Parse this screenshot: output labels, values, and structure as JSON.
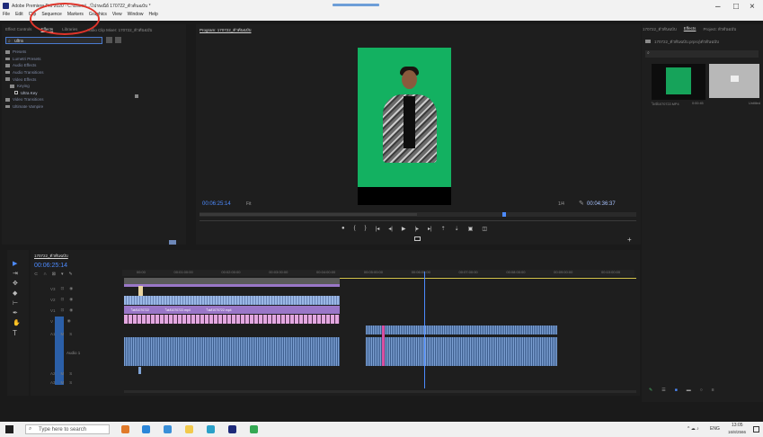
{
  "window": {
    "title": "Adobe Premiere Pro 2020 - C:\\Users\\...\\ไปรษณีย์ 170722_ตัวต้นฉบับ *",
    "menus": [
      "File",
      "Edit",
      "Clip",
      "Sequence",
      "Markers",
      "Graphics",
      "View",
      "Window",
      "Help"
    ],
    "controls": [
      "–",
      "□",
      "×"
    ]
  },
  "effects_panel": {
    "tabs": [
      "Effect Controls",
      "Effects",
      "Libraries",
      "Audio Clip Mixer: 170722_ตัวต้นฉบับ"
    ],
    "active_tab": "Effects",
    "search_value": "ultra",
    "tree": [
      "Presets",
      "Lumetri Presets",
      "Audio Effects",
      "Audio Transitions",
      "Video Effects",
      "Keying",
      "Ultra Key",
      "Video Transitions",
      "Ultimate Vampire"
    ]
  },
  "program_monitor": {
    "title": "Program: 170722_ตัวต้นฉบับ",
    "timecode_current": "00:06:25:14",
    "fit": "Fit",
    "quality": "1/4",
    "timecode_total": "00:04:36:37"
  },
  "project_panel": {
    "tabs": [
      "170722_ตัวต้นฉบับ",
      "Effects",
      "Project: ตัวต้นฉบับ"
    ],
    "path": "170722_ตัวต้นฉบับ.prproj\\ตัวต้นฉบับ",
    "items": [
      {
        "name": "ไฟล์1070722.MP4",
        "duration": "0:00:45"
      },
      {
        "name": "Untitled",
        "duration": ""
      }
    ]
  },
  "timeline": {
    "sequence_tab": "170722_ตัวต้นฉบับ",
    "timecode": "00:06:25:14",
    "ruler_labels": [
      "00:00",
      "00:01:00:00",
      "00:02:00:00",
      "00:03:00:00",
      "00:04:00:00",
      "00:05:00:00",
      "00:06:00:00",
      "00:07:00:00",
      "00:08:00:00",
      "00:09:00:00",
      "00:10:00:00"
    ],
    "track_labels": [
      "V3",
      "V2",
      "V1",
      "A1",
      "A2",
      "A3"
    ],
    "clip_labels": [
      "ไฟล์1070722",
      "ไฟล์1070722.mp4",
      "ไฟล์1070722.mp4"
    ],
    "audio_label": "Audio 1"
  },
  "taskbar": {
    "search_placeholder": "Type here to search",
    "lang": "ENG",
    "time": "13:05",
    "date": "16/8/2566"
  },
  "colors": {
    "accent_blue": "#4d8bff",
    "green_screen": "#13b161",
    "purple_clip": "#9a77c8",
    "pink_clip": "#e3a8e0",
    "audio_clip": "#7fa3d6",
    "highlight_circle": "#e0342a"
  }
}
